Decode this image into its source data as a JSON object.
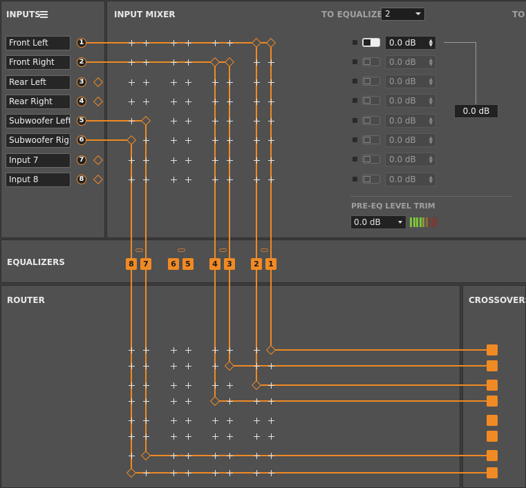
{
  "inputs_panel": {
    "title": "INPUTS",
    "menu_icon": "hamburger-menu-icon"
  },
  "input_channels": [
    {
      "label": "Front Left",
      "number": "1"
    },
    {
      "label": "Front Right",
      "number": "2"
    },
    {
      "label": "Rear Left",
      "number": "3"
    },
    {
      "label": "Rear Right",
      "number": "4"
    },
    {
      "label": "Subwoofer Left",
      "number": "5"
    },
    {
      "label": "Subwoofer Right",
      "number": "6"
    },
    {
      "label": "Input 7",
      "number": "7"
    },
    {
      "label": "Input 8",
      "number": "8"
    }
  ],
  "input_mixer": {
    "title": "INPUT MIXER",
    "to_equalizer_label": "TO EQUALIZER",
    "to_equalizer_value": "2",
    "to_label_cut": "TO",
    "gains": [
      {
        "value": "0.0 dB",
        "active": true
      },
      {
        "value": "0.0 dB",
        "active": false
      },
      {
        "value": "0.0 dB",
        "active": false
      },
      {
        "value": "0.0 dB",
        "active": false
      },
      {
        "value": "0.0 dB",
        "active": false
      },
      {
        "value": "0.0 dB",
        "active": false
      },
      {
        "value": "0.0 dB",
        "active": false
      },
      {
        "value": "0.0 dB",
        "active": false
      }
    ],
    "sum_gain": "0.0 dB",
    "pre_eq_label": "PRE-EQ LEVEL TRIM",
    "pre_eq_value": "0.0 dB",
    "level_meter_colors": [
      "#7ec63a",
      "#7ec63a",
      "#7ec63a",
      "#7ec63a",
      "#8a9a3a",
      "#8a6a3a",
      "#7a3a34",
      "#7a3a34",
      "#7a3a34"
    ]
  },
  "equalizers": {
    "title": "EQUALIZERS",
    "buttons": [
      "8",
      "7",
      "6",
      "5",
      "4",
      "3",
      "2",
      "1"
    ]
  },
  "router": {
    "title": "ROUTER"
  },
  "crossovers": {
    "title": "CROSSOVERS"
  },
  "colors": {
    "accent": "#f08a24",
    "panel": "#505050",
    "background": "#3c3c3c"
  }
}
